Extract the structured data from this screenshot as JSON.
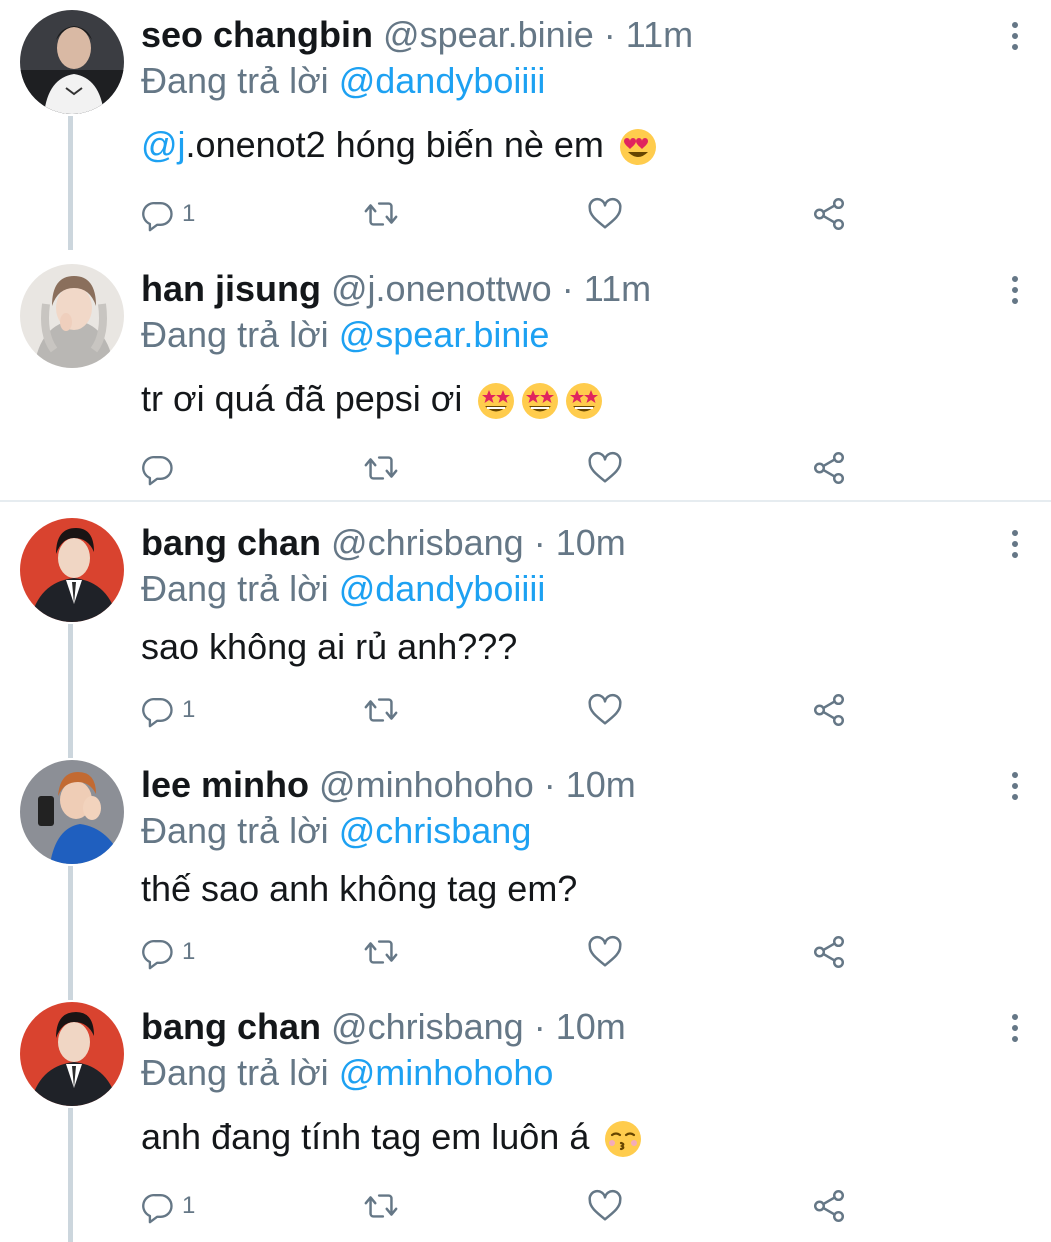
{
  "colors": {
    "accent": "#1da1f2",
    "muted": "#657786",
    "text": "#14171a",
    "line": "#ccd6dd"
  },
  "reply_prefix": "Đang trả lời",
  "tweets": [
    {
      "name": "seo changbin",
      "handle": "@spear.binie",
      "time": "11m",
      "reply_to": "@dandyboiiii",
      "mention": "@j",
      "text": ".onenot2 hóng biến nè em",
      "emojis": [
        "heart-eyes-emoji"
      ],
      "reply_count": "1"
    },
    {
      "name": "han jisung",
      "handle": "@j.onenottwo",
      "time": "11m",
      "reply_to": "@spear.binie",
      "text": "tr ơi quá đã pepsi ơi",
      "emojis": [
        "star-struck-emoji",
        "star-struck-emoji",
        "star-struck-emoji"
      ],
      "reply_count": ""
    },
    {
      "name": "bang chan",
      "handle": "@chrisbang",
      "time": "10m",
      "reply_to": "@dandyboiiii",
      "text": "sao không ai rủ anh???",
      "emojis": [],
      "reply_count": "1"
    },
    {
      "name": "lee minho",
      "handle": "@minhohoho",
      "time": "10m",
      "reply_to": "@chrisbang",
      "text": "thế sao anh không tag em?",
      "emojis": [],
      "reply_count": "1"
    },
    {
      "name": "bang chan",
      "handle": "@chrisbang",
      "time": "10m",
      "reply_to": "@minhohoho",
      "text": "anh đang tính tag em luôn á",
      "emojis": [
        "kissing-closed-eyes-emoji"
      ],
      "reply_count": "1"
    }
  ],
  "icons": [
    "reply-icon",
    "retweet-icon",
    "like-icon",
    "share-icon",
    "more-options-icon"
  ]
}
